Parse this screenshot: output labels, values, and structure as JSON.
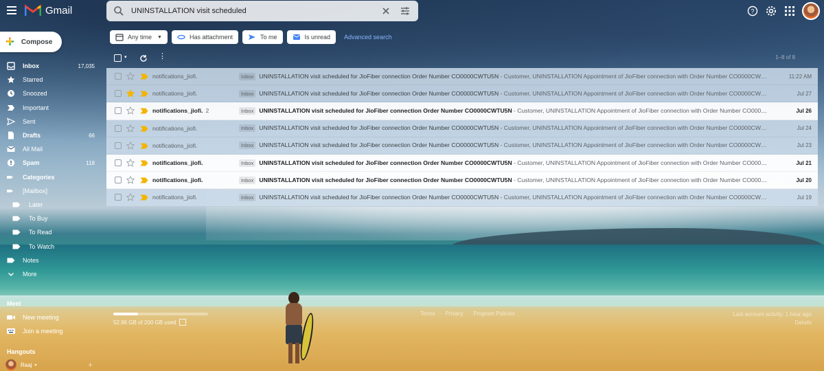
{
  "app": {
    "name": "Gmail"
  },
  "search": {
    "query": "UNINSTALLATION visit scheduled"
  },
  "compose": {
    "label": "Compose"
  },
  "nav": {
    "items": [
      {
        "label": "Inbox",
        "count": "17,035",
        "icon": "inbox-icon",
        "bold": true,
        "sub": false
      },
      {
        "label": "Starred",
        "count": "",
        "icon": "star-icon",
        "bold": false,
        "sub": false
      },
      {
        "label": "Snoozed",
        "count": "",
        "icon": "clock-icon",
        "bold": false,
        "sub": false
      },
      {
        "label": "Important",
        "count": "",
        "icon": "important-icon",
        "bold": false,
        "sub": false
      },
      {
        "label": "Sent",
        "count": "",
        "icon": "send-icon",
        "bold": false,
        "sub": false
      },
      {
        "label": "Drafts",
        "count": "66",
        "icon": "draft-icon",
        "bold": true,
        "sub": false
      },
      {
        "label": "All Mail",
        "count": "",
        "icon": "mail-icon",
        "bold": false,
        "sub": false
      },
      {
        "label": "Spam",
        "count": "118",
        "icon": "spam-icon",
        "bold": true,
        "sub": false
      },
      {
        "label": "Categories",
        "count": "",
        "icon": "expand-label-icon",
        "bold": true,
        "sub": false
      },
      {
        "label": "[Mailbox]",
        "count": "",
        "icon": "expand-label-icon",
        "bold": false,
        "sub": false
      },
      {
        "label": "Later",
        "count": "",
        "icon": "label-icon",
        "bold": false,
        "sub": true
      },
      {
        "label": "To Buy",
        "count": "",
        "icon": "label-icon",
        "bold": false,
        "sub": true
      },
      {
        "label": "To Read",
        "count": "",
        "icon": "label-icon",
        "bold": false,
        "sub": true
      },
      {
        "label": "To Watch",
        "count": "",
        "icon": "label-icon",
        "bold": false,
        "sub": true
      },
      {
        "label": "Notes",
        "count": "",
        "icon": "label-icon",
        "bold": false,
        "sub": false
      },
      {
        "label": "More",
        "count": "",
        "icon": "chevron-down-icon",
        "bold": false,
        "sub": false
      }
    ]
  },
  "meet": {
    "title": "Meet",
    "new_meeting": "New meeting",
    "join_meeting": "Join a meeting"
  },
  "hangouts": {
    "title": "Hangouts",
    "user": "Raaj"
  },
  "chips": {
    "any_time": "Any time",
    "has_attachment": "Has attachment",
    "to_me": "To me",
    "is_unread": "Is unread",
    "advanced_search": "Advanced search"
  },
  "toolbar": {
    "page_count": "1–8 of 8"
  },
  "emails": [
    {
      "sender": "notifications_jiofi.",
      "thread": "",
      "label": "Inbox",
      "subject": "UNINSTALLATION visit scheduled for JioFiber connection Order Number CO0000CWTU5N",
      "snippet": " - Customer, UNINSTALLATION Appointment of JioFiber connection with Order Number CO0000CWTU5N",
      "date": "11:22 AM",
      "unread": false,
      "starred": false
    },
    {
      "sender": "notifications_jiofi.",
      "thread": "",
      "label": "Inbox",
      "subject": "UNINSTALLATION visit scheduled for JioFiber connection Order Number CO0000CWTU5N",
      "snippet": " - Customer, UNINSTALLATION Appointment of JioFiber connection with Order Number CO0000CWTU5N",
      "date": "Jul 27",
      "unread": false,
      "starred": true
    },
    {
      "sender": "notifications_jiofi.",
      "thread": "2",
      "label": "Inbox",
      "subject": "UNINSTALLATION visit scheduled for JioFiber connection Order Number CO0000CWTU5N",
      "snippet": " - Customer, UNINSTALLATION Appointment of JioFiber connection with Order Number CO0000CWTU5N",
      "date": "Jul 26",
      "unread": true,
      "starred": false
    },
    {
      "sender": "notifications_jiofi.",
      "thread": "",
      "label": "Inbox",
      "subject": "UNINSTALLATION visit scheduled for JioFiber connection Order Number CO0000CWTU5N",
      "snippet": " - Customer, UNINSTALLATION Appointment of JioFiber connection with Order Number CO0000CWTU5N",
      "date": "Jul 24",
      "unread": false,
      "starred": false
    },
    {
      "sender": "notifications_jiofi.",
      "thread": "",
      "label": "Inbox",
      "subject": "UNINSTALLATION visit scheduled for JioFiber connection Order Number CO0000CWTU5N",
      "snippet": " - Customer, UNINSTALLATION Appointment of JioFiber connection with Order Number CO0000CWTU5N",
      "date": "Jul 23",
      "unread": false,
      "starred": false
    },
    {
      "sender": "notifications_jiofi.",
      "thread": "",
      "label": "Inbox",
      "subject": "UNINSTALLATION visit scheduled for JioFiber connection Order Number CO0000CWTU5N",
      "snippet": " - Customer, UNINSTALLATION Appointment of JioFiber connection with Order Number CO0000CWTU5N",
      "date": "Jul 21",
      "unread": true,
      "starred": false
    },
    {
      "sender": "notifications_jiofi.",
      "thread": "",
      "label": "Inbox",
      "subject": "UNINSTALLATION visit scheduled for JioFiber connection Order Number CO0000CWTU5N",
      "snippet": " - Customer, UNINSTALLATION Appointment of JioFiber connection with Order Number CO0000CWTU5N",
      "date": "Jul 20",
      "unread": true,
      "starred": false
    },
    {
      "sender": "notifications_jiofi.",
      "thread": "",
      "label": "Inbox",
      "subject": "UNINSTALLATION visit scheduled for JioFiber connection Order Number CO0000CWTU5N",
      "snippet": " - Customer, UNINSTALLATION Appointment of JioFiber connection with Order Number CO0000CWTU5N",
      "date": "Jul 19",
      "unread": false,
      "starred": false
    }
  ],
  "footer": {
    "storage_text": "52.96 GB of 200 GB used",
    "storage_used_fraction": 0.26,
    "links": [
      "Terms",
      "·",
      "Privacy",
      "·",
      "Program Policies"
    ],
    "last_activity": "Last account activity: 1 hour ago",
    "details": "Details"
  },
  "colors": {
    "star": "#f4b400",
    "important": "#f4b400",
    "link": "#8ab4f8"
  }
}
